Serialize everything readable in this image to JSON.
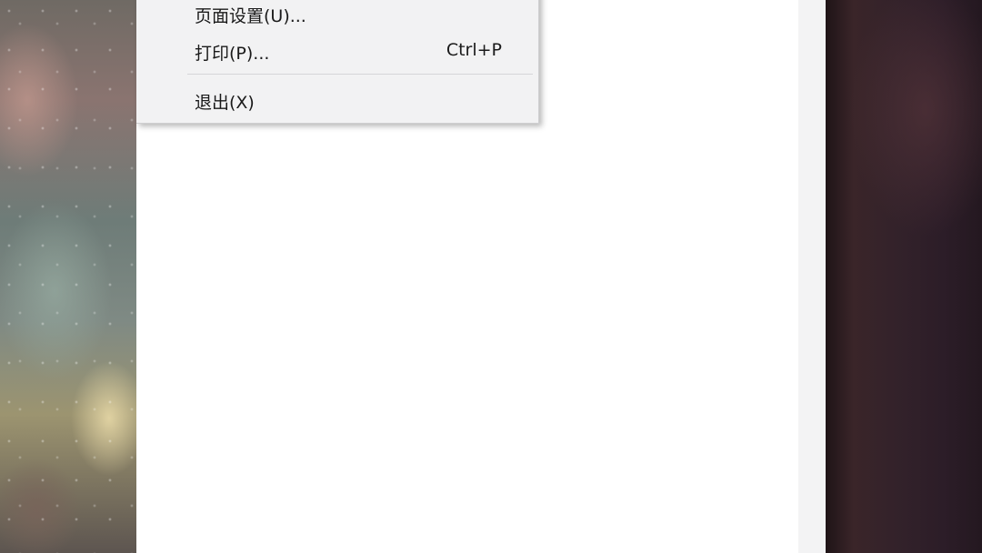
{
  "file_menu": {
    "items": [
      {
        "label": "页面设置(U)...",
        "shortcut": ""
      },
      {
        "label": "打印(P)...",
        "shortcut": "Ctrl+P"
      },
      {
        "label": "退出(X)",
        "shortcut": ""
      }
    ]
  }
}
